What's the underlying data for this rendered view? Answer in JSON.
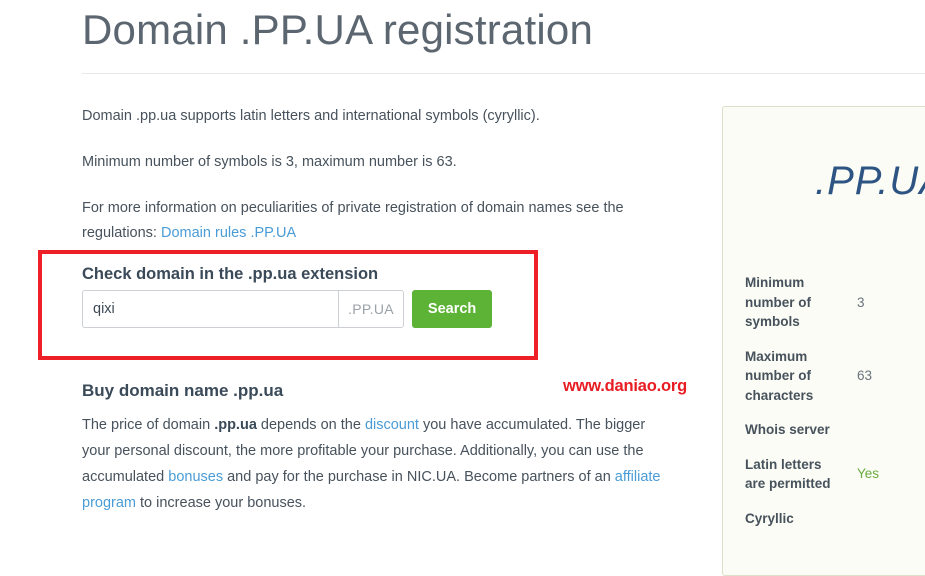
{
  "page": {
    "title": "Domain .PP.UA registration"
  },
  "intro": {
    "p1": "Domain .pp.ua supports latin letters and international symbols (cyryllic).",
    "p2": "Minimum number of symbols is 3, maximum number is 63.",
    "p3_before": "For more information on peculiarities of private registration of domain names see the regulations: ",
    "p3_link": "Domain rules .PP.UA"
  },
  "search": {
    "heading": "Check domain in the .pp.ua extension",
    "input_value": "qixi",
    "input_placeholder": "",
    "suffix": ".PP.UA",
    "button_label": "Search"
  },
  "buy": {
    "heading": "Buy domain name .pp.ua",
    "t1": "The price of domain ",
    "bold1": ".pp.ua",
    "t2": " depends on the ",
    "link1": "discount",
    "t3": " you have accumulated. The bigger your personal discount, the more profitable your purchase. Additionally, you can use the accumulated ",
    "link2": "bonuses",
    "t4": " and pay for the purchase in NIC.UA. Become partners of an ",
    "link3": "affiliate program",
    "t5": " to increase your bonuses."
  },
  "watermark": {
    "text": "www.daniao.org"
  },
  "sidebar": {
    "logo": ".PP.UA",
    "specs": [
      {
        "label": "Minimum number of symbols",
        "value": "3",
        "highlight": false
      },
      {
        "label": "Maximum number of characters",
        "value": "63",
        "highlight": false
      },
      {
        "label": "Whois server",
        "value": "",
        "highlight": false
      },
      {
        "label": "Latin letters are permitted",
        "value": "Yes",
        "highlight": true
      },
      {
        "label": "Cyryllic",
        "value": "",
        "highlight": false
      }
    ]
  },
  "colors": {
    "accent_green": "#5cb335",
    "link_blue": "#4a9cd6",
    "annotation_red": "#ed2028",
    "watermark_red": "#e81c23",
    "logo_blue": "#2d5483",
    "panel_bg": "#fbfcf5",
    "yes_green": "#6aab3f"
  }
}
